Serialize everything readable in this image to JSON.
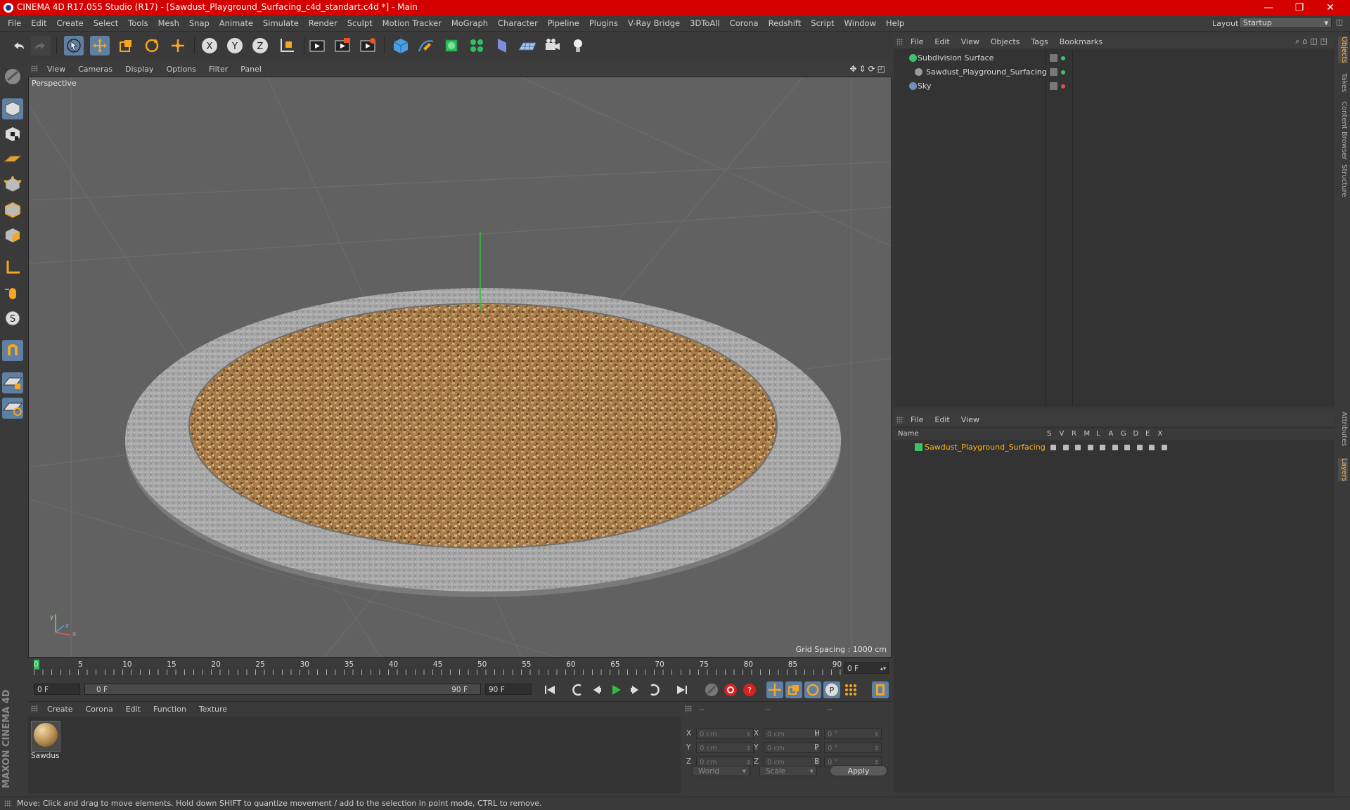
{
  "window": {
    "title": "CINEMA 4D R17.055 Studio (R17) - [Sawdust_Playground_Surfacing_c4d_standart.c4d *] - Main",
    "minimize": "—",
    "maximize": "❐",
    "close": "✕"
  },
  "menu": [
    "File",
    "Edit",
    "Create",
    "Select",
    "Tools",
    "Mesh",
    "Snap",
    "Animate",
    "Simulate",
    "Render",
    "Sculpt",
    "Motion Tracker",
    "MoGraph",
    "Character",
    "Pipeline",
    "Plugins",
    "V-Ray Bridge",
    "3DToAll",
    "Corona",
    "Redshift",
    "Script",
    "Window",
    "Help"
  ],
  "layout": {
    "label": "Layout:",
    "value": "Startup"
  },
  "viewport": {
    "menu": [
      "View",
      "Cameras",
      "Display",
      "Options",
      "Filter",
      "Panel"
    ],
    "camera_label": "Perspective",
    "grid_spacing": "Grid Spacing : 1000 cm",
    "axis_y": "y",
    "axis_x": "x",
    "axis_z": "z"
  },
  "timeline": {
    "ticks": [
      "0",
      "5",
      "10",
      "15",
      "20",
      "25",
      "30",
      "35",
      "40",
      "45",
      "50",
      "55",
      "60",
      "65",
      "70",
      "75",
      "80",
      "85",
      "90"
    ],
    "current_frame": "0 F",
    "start_field": "0 F",
    "slider_start": "0 F",
    "slider_end": "90 F",
    "end_field": "90 F"
  },
  "material_manager": {
    "menu": [
      "Create",
      "Corona",
      "Edit",
      "Function",
      "Texture"
    ],
    "materials": [
      {
        "name": "Sawdus"
      }
    ]
  },
  "coordinates": {
    "header": [
      "--",
      "--",
      "--"
    ],
    "rows": [
      {
        "a_label": "X",
        "a_value": "0 cm",
        "b_label": "X",
        "b_value": "0 cm",
        "c_label": "H",
        "c_value": "0 °"
      },
      {
        "a_label": "Y",
        "a_value": "0 cm",
        "b_label": "Y",
        "b_value": "0 cm",
        "c_label": "P",
        "c_value": "0 °"
      },
      {
        "a_label": "Z",
        "a_value": "0 cm",
        "b_label": "Z",
        "b_value": "0 cm",
        "c_label": "B",
        "c_value": "0 °"
      }
    ],
    "space_select": "World",
    "mode_select": "Scale",
    "apply": "Apply"
  },
  "object_manager": {
    "menu": [
      "File",
      "Edit",
      "View",
      "Objects",
      "Tags",
      "Bookmarks"
    ],
    "objects": [
      {
        "name": "Subdivision Surface",
        "color": "#3cc36a"
      },
      {
        "name": "Sawdust_Playground_Surfacing",
        "color": "#9a9a9a"
      },
      {
        "name": "Sky",
        "color": "#6f8fc0"
      }
    ]
  },
  "layer_manager": {
    "menu": [
      "File",
      "Edit",
      "View"
    ],
    "columns": [
      "Name",
      "S",
      "V",
      "R",
      "M",
      "L",
      "A",
      "G",
      "D",
      "E",
      "X"
    ],
    "rows": [
      {
        "name": "Sawdust_Playground_Surfacing",
        "color": "#ffb21e"
      }
    ]
  },
  "right_tabs": [
    "Objects",
    "Takes",
    "Content Browser",
    "Structure",
    "Attributes",
    "Layers"
  ],
  "status": "Move: Click and drag to move elements. Hold down SHIFT to quantize movement / add to the selection in point mode, CTRL to remove.",
  "brand": "MAXON CINEMA 4D",
  "colors": {
    "titlebar": "#d40000",
    "accent": "#ffb648",
    "selected_tool": "#5f7fa3"
  }
}
